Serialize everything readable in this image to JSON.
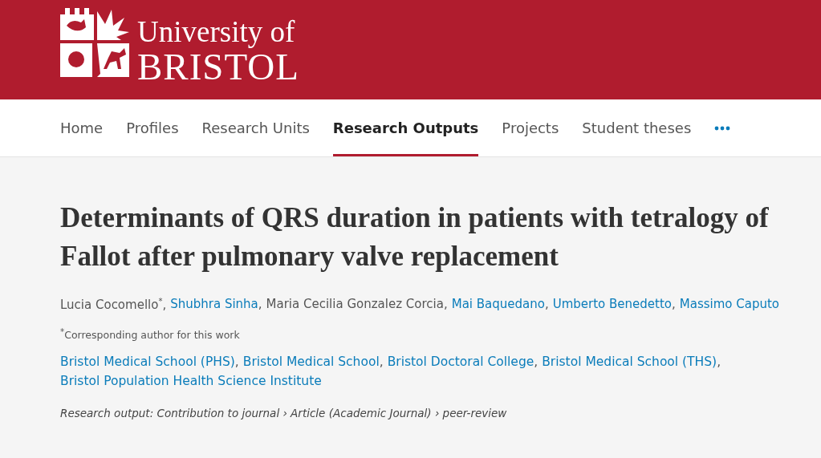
{
  "header": {
    "logo": {
      "line_1": "University of",
      "line_2": "BRISTOL"
    }
  },
  "nav": {
    "items": [
      {
        "label": "Home",
        "selected": false
      },
      {
        "label": "Profiles",
        "selected": false
      },
      {
        "label": "Research Units",
        "selected": false
      },
      {
        "label": "Research Outputs",
        "selected": true
      },
      {
        "label": "Projects",
        "selected": false
      },
      {
        "label": "Student theses",
        "selected": false
      }
    ]
  },
  "article": {
    "title": "Determinants of QRS duration in patients with tetralogy of Fallot after pulmonary valve replacement",
    "authors": [
      {
        "name": "Lucia Cocomello",
        "linked": false,
        "mark": "*",
        "sep": ","
      },
      {
        "name": "Shubhra Sinha",
        "linked": true,
        "sep": ","
      },
      {
        "name": "Maria Cecilia Gonzalez Corcia",
        "linked": false,
        "sep": ","
      },
      {
        "name": "Mai Baquedano",
        "linked": true,
        "sep": ","
      },
      {
        "name": "Umberto Benedetto",
        "linked": true,
        "sep": ","
      },
      {
        "name": "Massimo Caputo",
        "linked": true
      }
    ],
    "footnote": "$^{*}$Corresponding author for this work",
    "organisations": [
      {
        "name": "Bristol Medical School (PHS)",
        "sep": ","
      },
      {
        "name": "Bristol Medical School",
        "sep": ","
      },
      {
        "name": "Bristol Doctoral College",
        "sep": ","
      },
      {
        "name": "Bristol Medical School (THS)",
        "sep": ","
      },
      {
        "name": "Bristol Population Health Science Institute"
      }
    ],
    "output_type": "Research output: Contribution to journal › Article (Academic Journal) › peer-review"
  }
}
